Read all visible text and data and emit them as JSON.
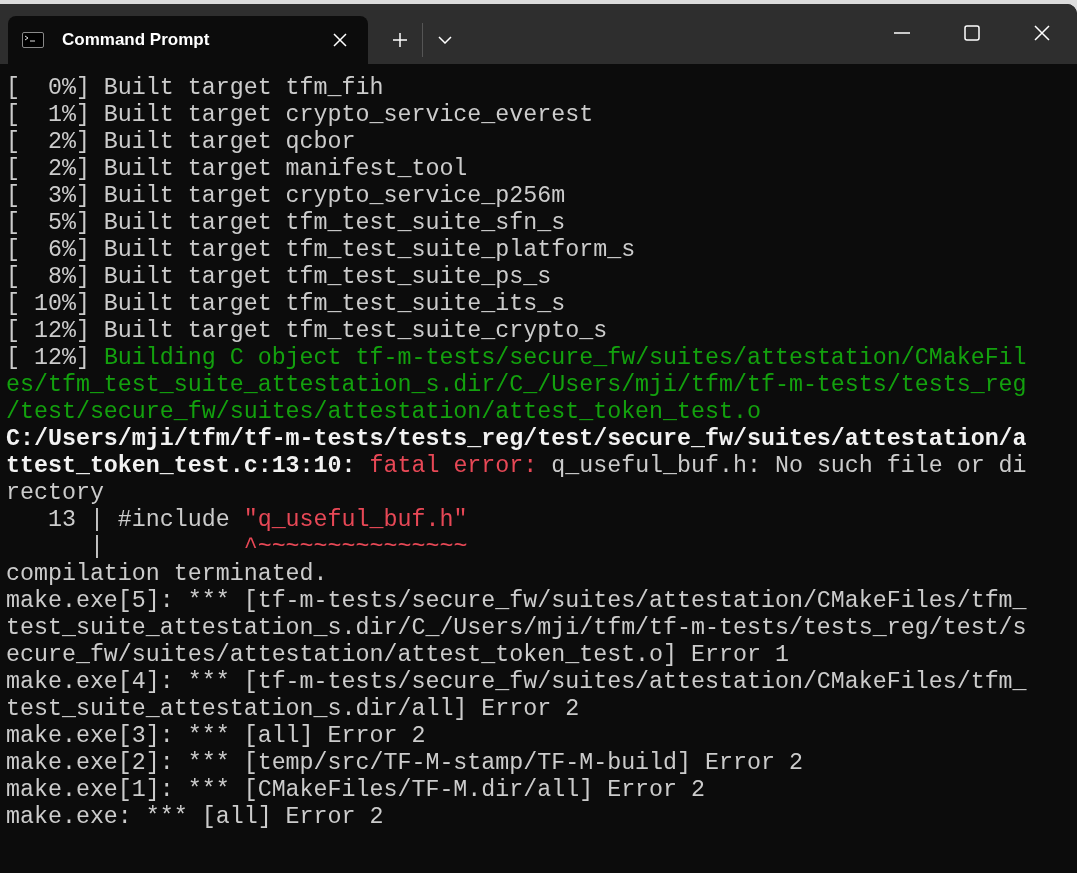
{
  "window": {
    "tab": {
      "title": "Command Prompt",
      "selected": true
    }
  },
  "lines": [
    [
      {
        "kind": "plain",
        "text": "[  0%] Built target tfm_fih"
      }
    ],
    [
      {
        "kind": "plain",
        "text": "[  1%] Built target crypto_service_everest"
      }
    ],
    [
      {
        "kind": "plain",
        "text": "[  2%] Built target qcbor"
      }
    ],
    [
      {
        "kind": "plain",
        "text": "[  2%] Built target manifest_tool"
      }
    ],
    [
      {
        "kind": "plain",
        "text": "[  3%] Built target crypto_service_p256m"
      }
    ],
    [
      {
        "kind": "plain",
        "text": "[  5%] Built target tfm_test_suite_sfn_s"
      }
    ],
    [
      {
        "kind": "plain",
        "text": "[  6%] Built target tfm_test_suite_platform_s"
      }
    ],
    [
      {
        "kind": "plain",
        "text": "[  8%] Built target tfm_test_suite_ps_s"
      }
    ],
    [
      {
        "kind": "plain",
        "text": "[ 10%] Built target tfm_test_suite_its_s"
      }
    ],
    [
      {
        "kind": "plain",
        "text": "[ 12%] Built target tfm_test_suite_crypto_s"
      }
    ],
    [
      {
        "kind": "plain",
        "text": "[ 12%] "
      },
      {
        "kind": "green",
        "text": "Building C object tf-m-tests/secure_fw/suites/attestation/CMakeFil"
      }
    ],
    [
      {
        "kind": "green",
        "text": "es/tfm_test_suite_attestation_s.dir/C_/Users/mji/tfm/tf-m-tests/tests_reg"
      }
    ],
    [
      {
        "kind": "green",
        "text": "/test/secure_fw/suites/attestation/attest_token_test.o"
      }
    ],
    [
      {
        "kind": "bold",
        "text": "C:/Users/mji/tfm/tf-m-tests/tests_reg/test/secure_fw/suites/attestation/a"
      }
    ],
    [
      {
        "kind": "bold",
        "text": "ttest_token_test.c:13:10: "
      },
      {
        "kind": "red",
        "text": "fatal error: "
      },
      {
        "kind": "plain",
        "text": "q_useful_buf.h: No such file or di"
      }
    ],
    [
      {
        "kind": "plain",
        "text": "rectory"
      }
    ],
    [
      {
        "kind": "plain",
        "text": "   13 | #include "
      },
      {
        "kind": "red",
        "text": "\"q_useful_buf.h\""
      }
    ],
    [
      {
        "kind": "plain",
        "text": "      |          "
      },
      {
        "kind": "red",
        "text": "^~~~~~~~~~~~~~~~"
      }
    ],
    [
      {
        "kind": "plain",
        "text": "compilation terminated."
      }
    ],
    [
      {
        "kind": "plain",
        "text": "make.exe[5]: *** [tf-m-tests/secure_fw/suites/attestation/CMakeFiles/tfm_"
      }
    ],
    [
      {
        "kind": "plain",
        "text": "test_suite_attestation_s.dir/C_/Users/mji/tfm/tf-m-tests/tests_reg/test/s"
      }
    ],
    [
      {
        "kind": "plain",
        "text": "ecure_fw/suites/attestation/attest_token_test.o] Error 1"
      }
    ],
    [
      {
        "kind": "plain",
        "text": "make.exe[4]: *** [tf-m-tests/secure_fw/suites/attestation/CMakeFiles/tfm_"
      }
    ],
    [
      {
        "kind": "plain",
        "text": "test_suite_attestation_s.dir/all] Error 2"
      }
    ],
    [
      {
        "kind": "plain",
        "text": "make.exe[3]: *** [all] Error 2"
      }
    ],
    [
      {
        "kind": "plain",
        "text": "make.exe[2]: *** [temp/src/TF-M-stamp/TF-M-build] Error 2"
      }
    ],
    [
      {
        "kind": "plain",
        "text": "make.exe[1]: *** [CMakeFiles/TF-M.dir/all] Error 2"
      }
    ],
    [
      {
        "kind": "plain",
        "text": "make.exe: *** [all] Error 2"
      }
    ]
  ]
}
